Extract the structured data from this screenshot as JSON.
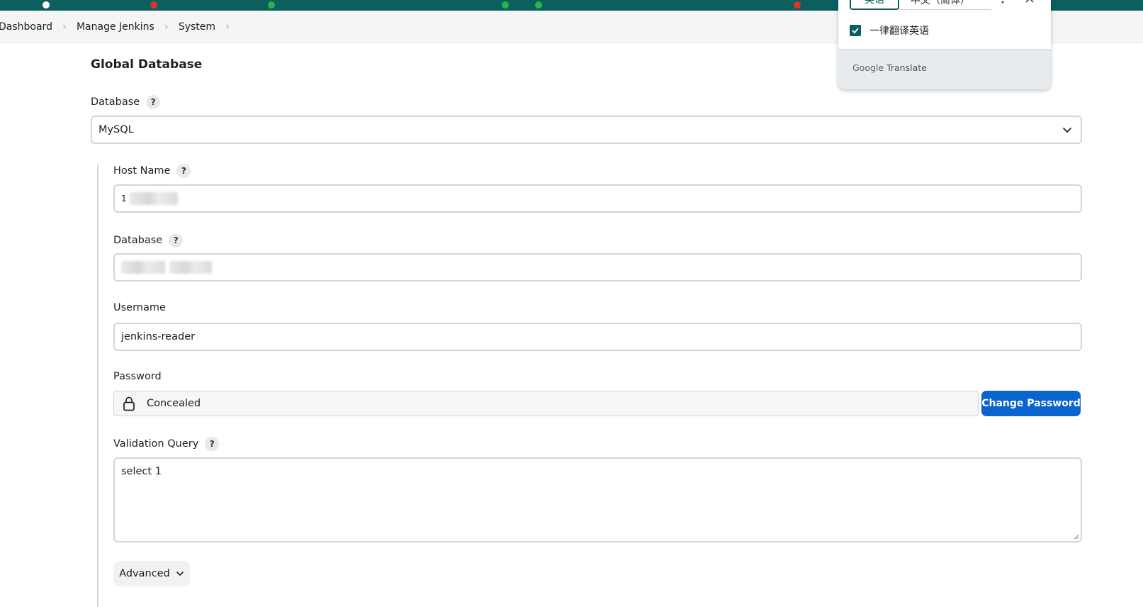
{
  "breadcrumb": {
    "items": [
      "Dashboard",
      "Manage Jenkins",
      "System"
    ]
  },
  "section": {
    "title": "Global Database"
  },
  "database_select": {
    "label": "Database",
    "help": "?",
    "value": "MySQL"
  },
  "host_name": {
    "label": "Host Name",
    "help": "?",
    "value_visible": "1"
  },
  "database_name": {
    "label": "Database",
    "help": "?"
  },
  "username": {
    "label": "Username",
    "value": "jenkins-reader"
  },
  "password": {
    "label": "Password",
    "value": "Concealed",
    "change_button": "Change Password"
  },
  "validation_query": {
    "label": "Validation Query",
    "help": "?",
    "value": "select 1"
  },
  "advanced": {
    "label": "Advanced"
  },
  "translate_popup": {
    "tab_source": "英语",
    "tab_target": "中文（简体）",
    "always_translate_label": "一律翻译英语",
    "always_translate_checked": true,
    "brand": "Google",
    "brand_suffix": "Translate"
  },
  "colors": {
    "primary_button": "#0b63ce",
    "top_bar": "#0b5f5f",
    "translate_accent": "#0b5f5f"
  }
}
